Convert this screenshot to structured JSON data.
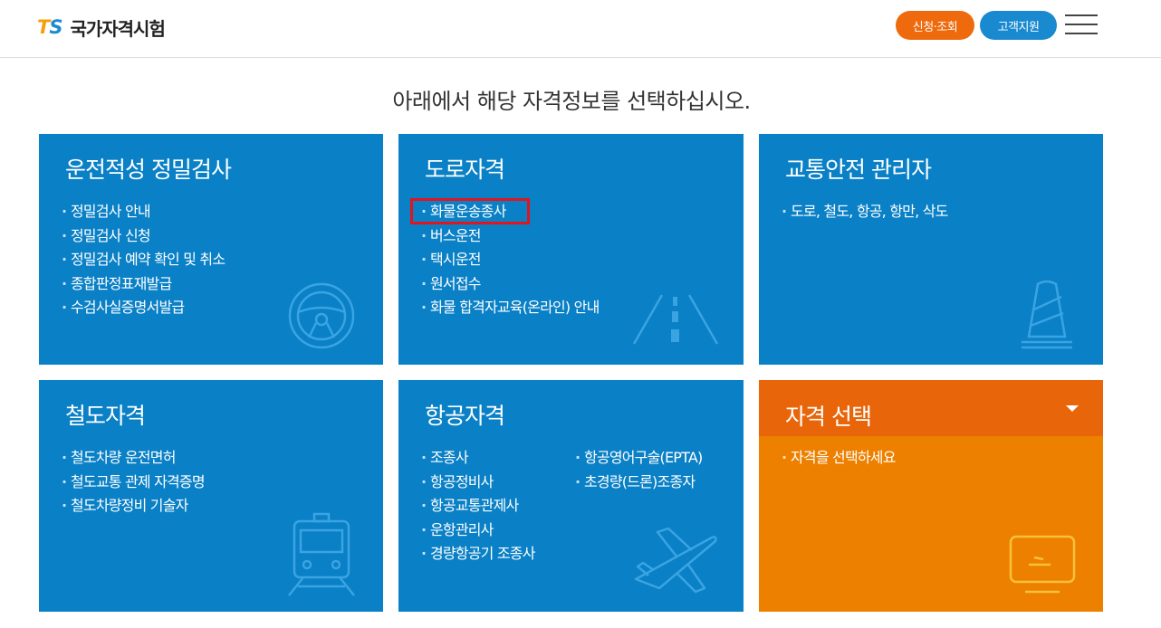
{
  "header": {
    "logo_mark_t": "T",
    "logo_mark_s": "S",
    "logo_text": "국가자격시험",
    "apply_label": "신청·조회",
    "support_label": "고객지원"
  },
  "page_title": "아래에서 해당 자격정보를 선택하십시오.",
  "cards": {
    "aptitude": {
      "title": "운전적성 정밀검사",
      "items": [
        "정밀검사 안내",
        "정밀검사 신청",
        "정밀검사 예약 확인 및 취소",
        "종합판정표재발급",
        "수검사실증명서발급"
      ],
      "icon": "steering-wheel-icon"
    },
    "road": {
      "title": "도로자격",
      "items": [
        "화물운송종사",
        "버스운전",
        "택시운전",
        "원서접수",
        "화물 합격자교육(온라인) 안내"
      ],
      "icon": "road-icon"
    },
    "safety": {
      "title": "교통안전 관리자",
      "items": [
        "도로, 철도, 항공, 항만, 삭도"
      ],
      "icon": "traffic-cone-icon"
    },
    "rail": {
      "title": "철도자격",
      "items": [
        "철도차량 운전면허",
        "철도교통 관제 자격증명",
        "철도차량정비 기술자"
      ],
      "icon": "train-icon"
    },
    "aviation": {
      "title": "항공자격",
      "items_left": [
        "조종사",
        "항공정비사",
        "항공교통관제사",
        "운항관리사",
        "경량항공기 조종사"
      ],
      "items_right": [
        "항공영어구술(EPTA)",
        "초경량(드론)조종자"
      ],
      "icon": "airplane-icon"
    },
    "select": {
      "title": "자격 선택",
      "placeholder": "자격을 선택하세요",
      "icon": "monitor-icon"
    }
  },
  "colors": {
    "card_blue": "#0a80c6",
    "card_orange": "#ee8000",
    "header_orange": "#e8650a",
    "apply_button": "#ee6a0c",
    "support_button": "#1a8ad0",
    "highlight": "#e3141b"
  }
}
